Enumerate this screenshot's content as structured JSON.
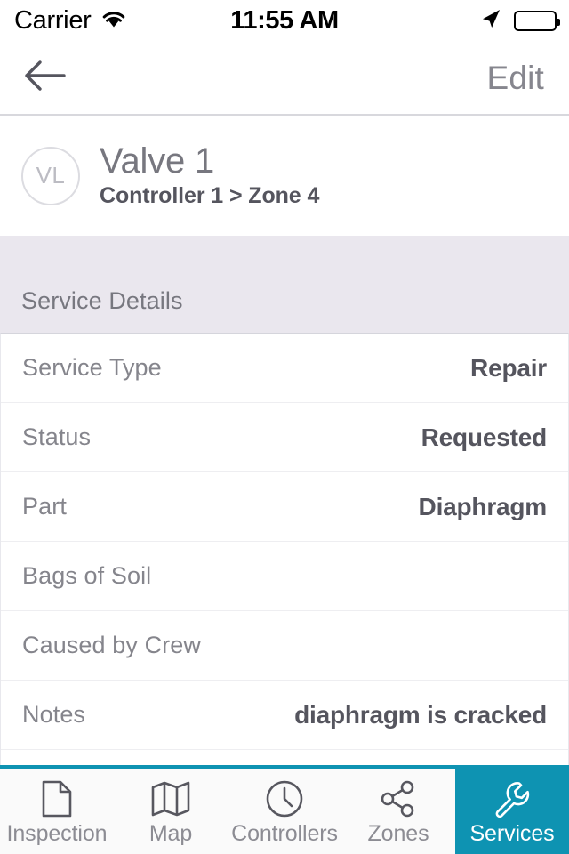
{
  "status_bar": {
    "carrier": "Carrier",
    "wifi_icon": "wifi-icon",
    "time": "11:55 AM",
    "location_icon": "location-arrow-icon",
    "battery_icon": "battery-full-icon"
  },
  "nav_bar": {
    "back_icon": "back-arrow-icon",
    "edit_label": "Edit"
  },
  "entity_header": {
    "avatar_initials": "VL",
    "title": "Valve 1",
    "subtitle": "Controller 1 > Zone 4"
  },
  "section": {
    "title": "Service Details",
    "rows": [
      {
        "label": "Service Type",
        "value": "Repair"
      },
      {
        "label": "Status",
        "value": "Requested"
      },
      {
        "label": "Part",
        "value": "Diaphragm"
      },
      {
        "label": "Bags of Soil",
        "value": ""
      },
      {
        "label": "Caused by Crew",
        "value": ""
      },
      {
        "label": "Notes",
        "value": "diaphragm is cracked"
      }
    ]
  },
  "tab_bar": {
    "active_index": 4,
    "items": [
      {
        "label": "Inspection",
        "icon": "document-icon"
      },
      {
        "label": "Map",
        "icon": "map-icon"
      },
      {
        "label": "Controllers",
        "icon": "clock-icon"
      },
      {
        "label": "Zones",
        "icon": "share-nodes-icon"
      },
      {
        "label": "Services",
        "icon": "wrench-icon"
      }
    ]
  },
  "colors": {
    "accent_teal": "#0e93b2",
    "section_bg": "#eae7ee",
    "label_gray": "#85858c",
    "value_gray": "#55555e"
  }
}
